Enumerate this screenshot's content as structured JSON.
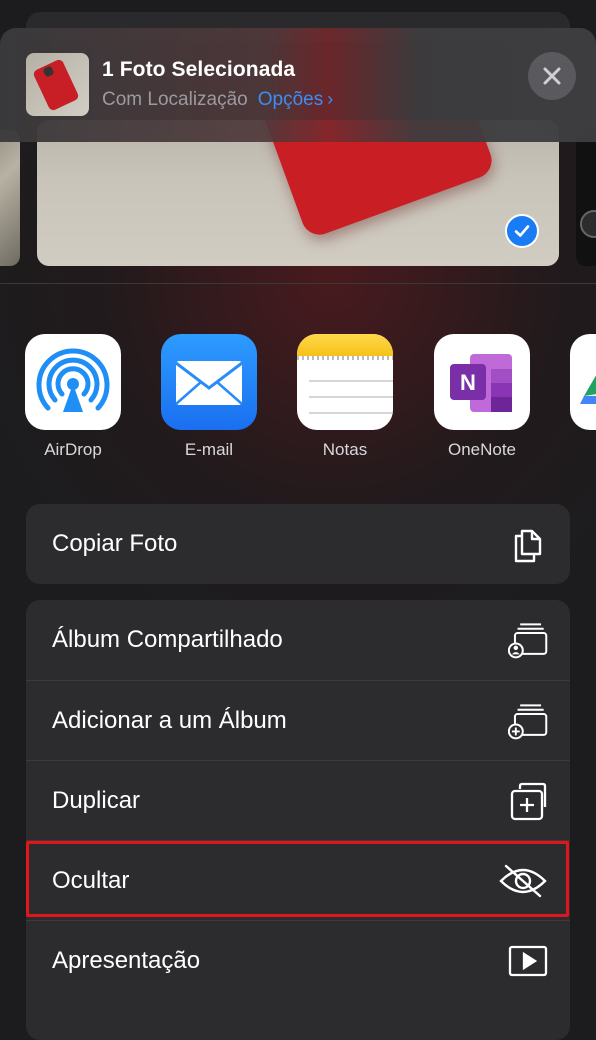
{
  "header": {
    "title": "1 Foto Selecionada",
    "location_label": "Com Localização",
    "options_label": "Opções",
    "close_icon": "close-icon"
  },
  "apps": [
    {
      "label": "AirDrop",
      "icon": "airdrop-icon"
    },
    {
      "label": "E-mail",
      "icon": "mail-icon"
    },
    {
      "label": "Notas",
      "icon": "notes-icon"
    },
    {
      "label": "OneNote",
      "icon": "onenote-icon"
    }
  ],
  "actions_top": [
    {
      "label": "Copiar Foto",
      "icon": "copy-icon"
    }
  ],
  "actions": [
    {
      "label": "Álbum Compartilhado",
      "icon": "shared-album-icon"
    },
    {
      "label": "Adicionar a um Álbum",
      "icon": "add-album-icon"
    },
    {
      "label": "Duplicar",
      "icon": "duplicate-icon"
    },
    {
      "label": "Ocultar",
      "icon": "eye-slash-icon",
      "highlighted": true
    },
    {
      "label": "Apresentação",
      "icon": "play-icon"
    }
  ],
  "colors": {
    "accent": "#3b8ef6",
    "highlight": "#e1151a",
    "background": "#1c1c1e"
  }
}
